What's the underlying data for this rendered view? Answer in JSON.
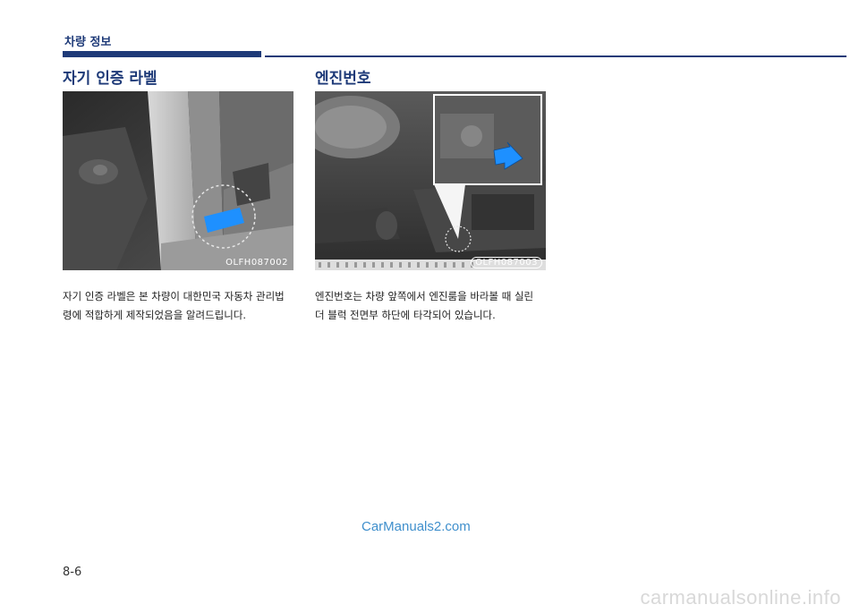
{
  "header": {
    "title": "차량 정보"
  },
  "left": {
    "title": "자기 인증 라벨",
    "image_code": "OLFH087002",
    "text_lines": [
      "자기 인증 라벨은 본 차량이 대한민국 자동차 관리법",
      "령에 적합하게 제작되었음을 알려드립니다."
    ]
  },
  "right": {
    "title": "엔진번호",
    "image_code": "OLFH087003",
    "text_lines": [
      "엔진번호는 차량 앞쪽에서 엔진룸을 바라볼 때 실린",
      "더 블럭 전면부 하단에 타각되어 있습니다."
    ]
  },
  "watermark": "CarManuals2.com",
  "page_number": "8-6",
  "footer_site": "carmanualsonline.info",
  "colors": {
    "accent": "#1e3a78",
    "highlight": "#1e90ff",
    "watermark": "#3f8fcc"
  }
}
